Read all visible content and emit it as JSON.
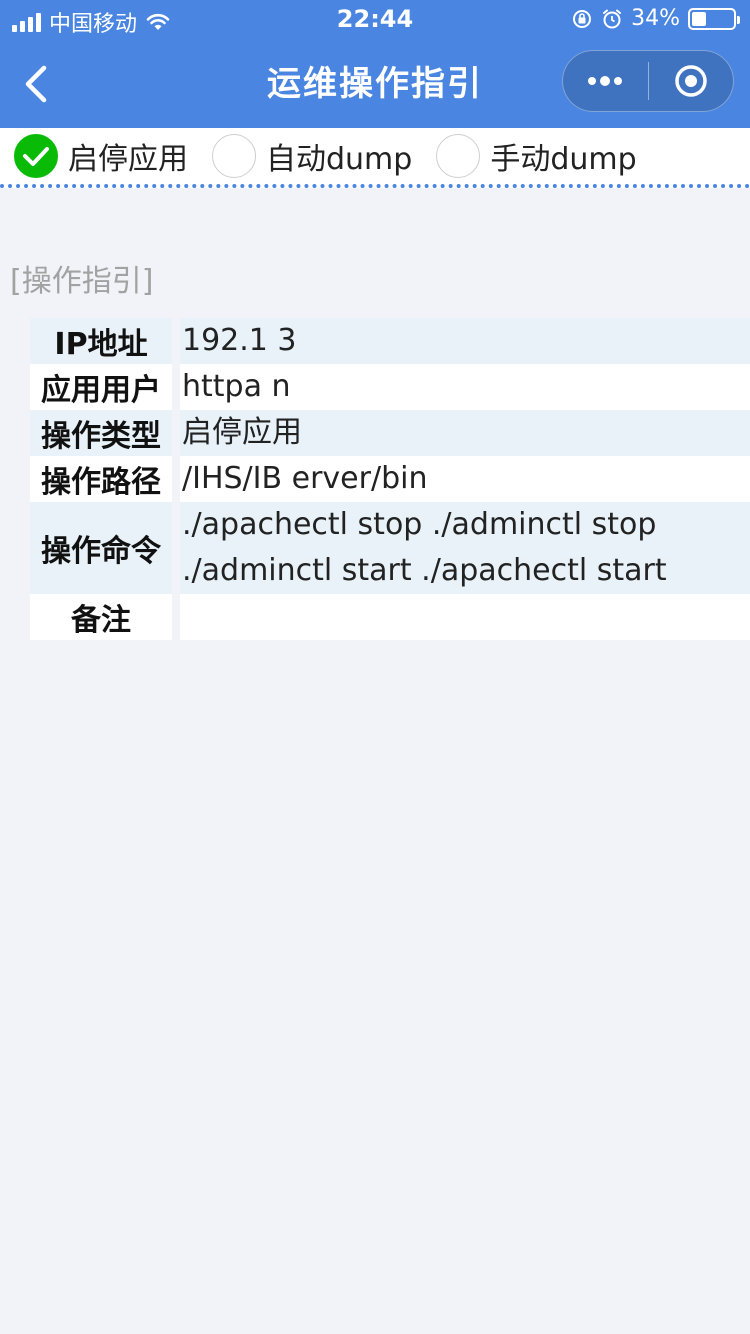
{
  "status_bar": {
    "carrier": "中国移动",
    "time": "22:44",
    "battery": "34%",
    "battery_level": 0.34,
    "icons": [
      "signal-icon",
      "wifi-icon",
      "orientation-lock-icon",
      "alarm-icon",
      "battery-icon"
    ]
  },
  "nav": {
    "title": "运维操作指引",
    "icons": [
      "back-chevron-icon",
      "more-dots-icon",
      "target-icon"
    ]
  },
  "tabs": [
    {
      "label": "启停应用",
      "selected": true
    },
    {
      "label": "自动dump",
      "selected": false
    },
    {
      "label": "手动dump",
      "selected": false
    }
  ],
  "section": {
    "title": "[操作指引]"
  },
  "table": {
    "rows": [
      {
        "key": "IP地址",
        "value": "192.1 3"
      },
      {
        "key": "应用用户",
        "value": "httpa n"
      },
      {
        "key": "操作类型",
        "value": "启停应用"
      },
      {
        "key": "操作路径",
        "value": "/IHS/IB erver/bin"
      },
      {
        "key": "操作命令",
        "lines": [
          "./apachectl stop ./adminctl stop",
          "./adminctl start ./apachectl start"
        ]
      },
      {
        "key": "备注",
        "value": ""
      }
    ]
  },
  "colors": {
    "header": "#4a86e1",
    "row_shade": "#e8f2f8",
    "check": "#09bb07"
  }
}
